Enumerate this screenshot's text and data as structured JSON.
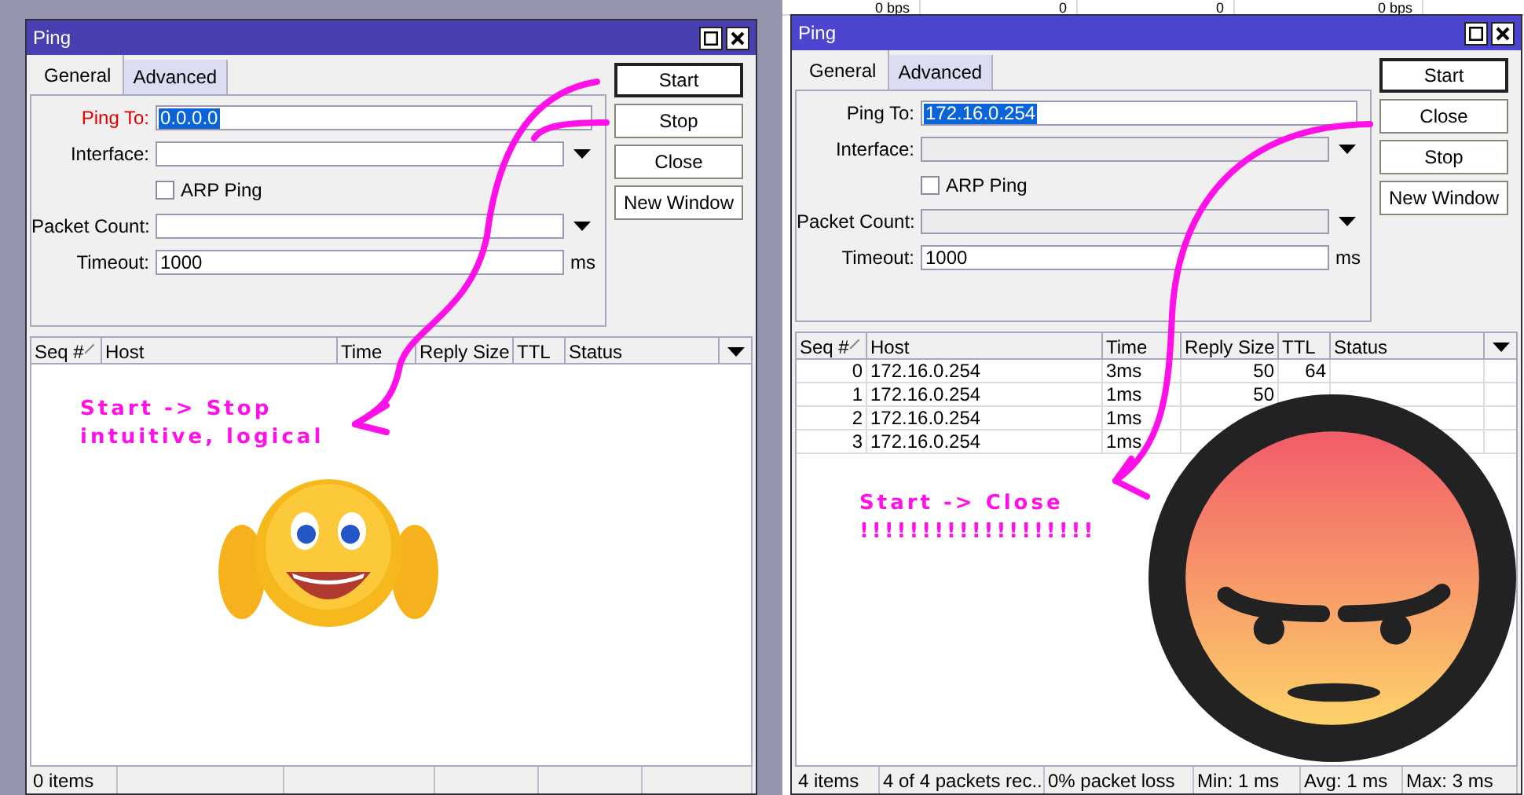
{
  "background_window": {
    "cells": [
      "0 bps",
      "0",
      "0",
      "0 bps"
    ]
  },
  "windows": [
    {
      "title": "Ping",
      "active": false,
      "tabs": [
        {
          "label": "General",
          "selected": true
        },
        {
          "label": "Advanced",
          "selected": false
        }
      ],
      "fields": [
        {
          "kind": "text",
          "label": "Ping To:",
          "value": "0.0.0.0",
          "required": true,
          "disabled": false,
          "value_selected": true
        },
        {
          "kind": "dropdown",
          "label": "Interface:",
          "required": false,
          "disabled": false
        },
        {
          "kind": "checkbox",
          "label": "ARP Ping",
          "checked": false
        },
        {
          "kind": "dropdown",
          "label": "Packet Count:",
          "required": false,
          "disabled": false
        },
        {
          "kind": "unit",
          "label": "Timeout:",
          "value": "1000",
          "unit": "ms",
          "required": false,
          "disabled": false,
          "value_selected": false
        }
      ],
      "buttons": [
        {
          "label": "Start",
          "default": true
        },
        {
          "label": "Stop",
          "default": false
        },
        {
          "label": "Close",
          "default": false
        },
        {
          "label": "New Window",
          "default": false
        }
      ],
      "table": {
        "columns": [
          {
            "label": "Seq #",
            "sorted": true
          },
          {
            "label": "Host",
            "sorted": false
          },
          {
            "label": "Time",
            "sorted": false
          },
          {
            "label": "Reply Size",
            "sorted": false
          },
          {
            "label": "TTL",
            "sorted": false
          },
          {
            "label": "Status",
            "sorted": false
          }
        ]
      },
      "status_bar": [
        "0 items"
      ],
      "annotation": {
        "lines": [
          "Start -> Stop",
          "intuitive, logical"
        ]
      }
    },
    {
      "title": "Ping",
      "active": true,
      "tabs": [
        {
          "label": "General",
          "selected": true
        },
        {
          "label": "Advanced",
          "selected": false
        }
      ],
      "fields": [
        {
          "kind": "text",
          "label": "Ping To:",
          "value": "172.16.0.254",
          "required": false,
          "disabled": false,
          "value_selected": true
        },
        {
          "kind": "dropdown",
          "label": "Interface:",
          "required": false,
          "disabled": true
        },
        {
          "kind": "checkbox",
          "label": "ARP Ping",
          "checked": false
        },
        {
          "kind": "dropdown",
          "label": "Packet Count:",
          "required": false,
          "disabled": true
        },
        {
          "kind": "unit",
          "label": "Timeout:",
          "value": "1000",
          "unit": "ms",
          "required": false,
          "disabled": false,
          "value_selected": false
        }
      ],
      "buttons": [
        {
          "label": "Start",
          "default": true
        },
        {
          "label": "Close",
          "default": false
        },
        {
          "label": "Stop",
          "default": false
        },
        {
          "label": "New Window",
          "default": false
        }
      ],
      "table": {
        "columns": [
          {
            "label": "Seq #",
            "sorted": true
          },
          {
            "label": "Host",
            "sorted": false
          },
          {
            "label": "Time",
            "sorted": false
          },
          {
            "label": "Reply Size",
            "sorted": false
          },
          {
            "label": "TTL",
            "sorted": false
          },
          {
            "label": "Status",
            "sorted": false
          }
        ],
        "rows": [
          {
            "seq": "0",
            "host": "172.16.0.254",
            "time": "3ms",
            "reply_size": "50",
            "ttl": "64"
          },
          {
            "seq": "1",
            "host": "172.16.0.254",
            "time": "1ms",
            "reply_size": "50"
          },
          {
            "seq": "2",
            "host": "172.16.0.254",
            "time": "1ms"
          },
          {
            "seq": "3",
            "host": "172.16.0.254",
            "time": "1ms"
          }
        ]
      },
      "status_bar": [
        "4 items",
        "4 of 4 packets rec...",
        "0% packet loss",
        "Min: 1 ms",
        "Avg: 1 ms",
        "Max: 3 ms"
      ],
      "annotation": {
        "lines": [
          "Start -> Close",
          "!!!!!!!!!!!!!!!!!!!"
        ]
      }
    }
  ]
}
